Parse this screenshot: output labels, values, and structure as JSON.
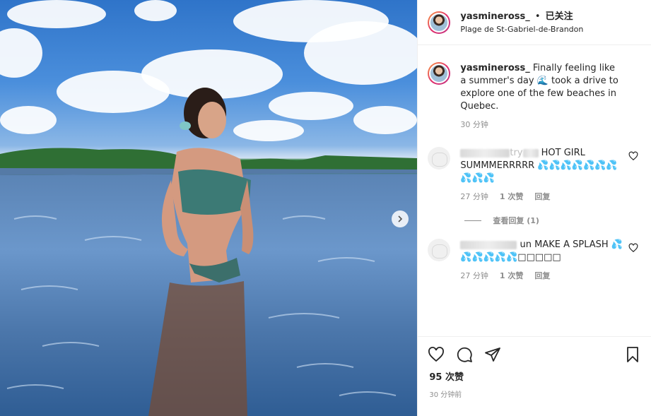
{
  "post": {
    "username": "yasmineross_",
    "follow_status": "已关注",
    "separator": "•",
    "location": "Plage de St-Gabriel-de-Brandon"
  },
  "caption": {
    "username": "yasmineross_",
    "text": "Finally feeling like a summer's day 🌊 took a drive to explore one of the few beaches in Quebec.",
    "time": "30 分钟"
  },
  "comments": [
    {
      "username_visible_suffix": "try",
      "text": "HOT GIRL SUMMMERRRRR 💦💦💦💦💦💦💦💦💦💦",
      "time": "27 分钟",
      "likes": "1 次赞",
      "reply": "回复",
      "view_replies": "查看回复 (1)"
    },
    {
      "username_visible_suffix": "un",
      "text": "MAKE A SPLASH 💦💦💦💦💦💦□□□□□",
      "time": "27 分钟",
      "likes": "1 次赞",
      "reply": "回复"
    }
  ],
  "footer": {
    "likes": "95 次赞",
    "time": "30 分钟前"
  },
  "icons": {
    "heart": "heart-icon",
    "comment": "comment-icon",
    "share": "share-icon",
    "bookmark": "bookmark-icon",
    "next": "chevron-right-icon"
  },
  "colors": {
    "text": "#262626",
    "muted": "#8e8e8e",
    "border": "#efefef"
  }
}
